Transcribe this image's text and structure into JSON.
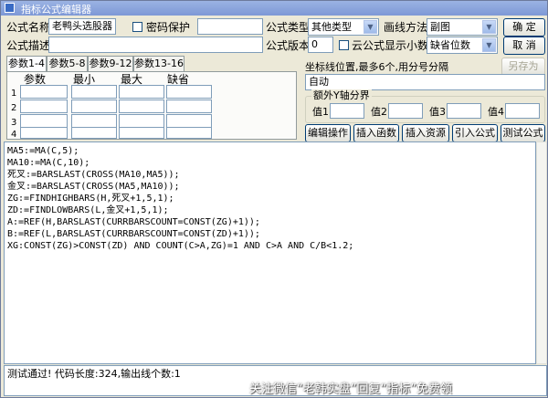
{
  "window": {
    "title": "指标公式编辑器"
  },
  "form": {
    "name_label": "公式名称",
    "name_value": "老鸭头选股器",
    "password_label": "密码保护",
    "desc_label": "公式描述",
    "desc_value": "",
    "type_label": "公式类型",
    "type_value": "其他类型",
    "draw_label": "画线方法",
    "draw_value": "副图",
    "version_label": "公式版本",
    "version_value": "0",
    "cloud_label": "云公式",
    "decimals_label": "显示小数",
    "decimals_value": "缺省位数"
  },
  "buttons": {
    "ok": "确 定",
    "cancel": "取 消",
    "save_as": "另存为",
    "edit_ops": "编辑操作",
    "insert_func": "插入函数",
    "insert_res": "插入资源",
    "import": "引入公式",
    "test": "测试公式"
  },
  "tabs": [
    {
      "label": "参数1-4"
    },
    {
      "label": "参数5-8"
    },
    {
      "label": "参数9-12"
    },
    {
      "label": "参数13-16"
    }
  ],
  "params": {
    "headers": [
      "参数",
      "最小",
      "最大",
      "缺省"
    ],
    "rows": [
      "1",
      "2",
      "3",
      "4"
    ]
  },
  "axis": {
    "label": "坐标线位置,最多6个,用分号分隔",
    "value": "自动",
    "group_label": "额外Y轴分界",
    "val1": "值1",
    "val2": "值2",
    "val3": "值3",
    "val4": "值4"
  },
  "code_lines": [
    "MA5:=MA(C,5);",
    "MA10:=MA(C,10);",
    "死叉:=BARSLAST(CROSS(MA10,MA5));",
    "金叉:=BARSLAST(CROSS(MA5,MA10));",
    "ZG:=FINDHIGHBARS(H,死叉+1,5,1);",
    "ZD:=FINDLOWBARS(L,金叉+1,5,1);",
    "A:=REF(H,BARSLAST(CURRBARSCOUNT=CONST(ZG)+1));",
    "B:=REF(L,BARSLAST(CURRBARSCOUNT=CONST(ZD)+1));",
    "XG:CONST(ZG)>CONST(ZD) AND COUNT(C>A,ZG)=1 AND C>A AND C/B<1.2;"
  ],
  "status": {
    "text": "测试通过! 代码长度:324,输出线个数:1"
  },
  "watermark": {
    "text": "关注微信“老韩实盘”回复“指标”免费领"
  }
}
